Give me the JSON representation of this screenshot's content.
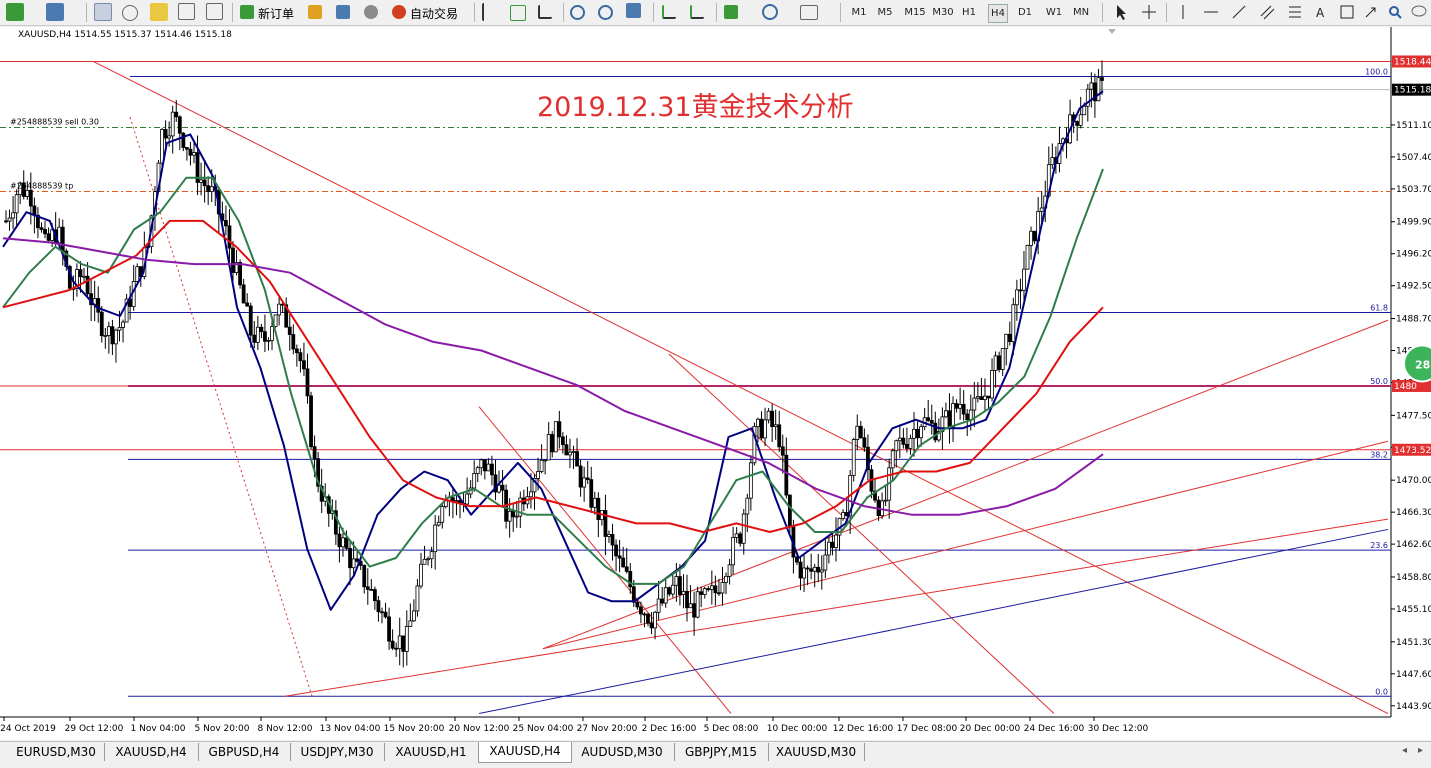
{
  "toolbar": {
    "new_order_label": "新订单",
    "auto_trade_label": "自动交易",
    "timeframes": [
      "M1",
      "M5",
      "M15",
      "M30",
      "H1",
      "H4",
      "D1",
      "W1",
      "MN"
    ],
    "active_timeframe": "H4"
  },
  "chart_header": {
    "symbol_line": "XAUUSD,H4  1514.55 1515.37 1514.46 1515.18"
  },
  "annotation_title": "2019.12.31黄金技术分析",
  "order_labels": [
    {
      "text": "#254888539 sell 0.30",
      "price": 1510.8
    },
    {
      "text": "#254888539 tp",
      "price": 1503.4
    }
  ],
  "fib_labels": [
    {
      "text": "100.0",
      "price": 1516.7
    },
    {
      "text": "61.8",
      "price": 1489.4
    },
    {
      "text": "50.0",
      "price": 1480.9
    },
    {
      "text": "38.2",
      "price": 1472.4
    },
    {
      "text": "23.6",
      "price": 1461.9
    },
    {
      "text": "0.0",
      "price": 1445.0
    }
  ],
  "price_tags": [
    {
      "text": "1518.44",
      "price": 1518.44,
      "color": "#e03030"
    },
    {
      "text": "1515.18",
      "price": 1515.18,
      "color": "#000000"
    },
    {
      "text": "1480",
      "price": 1480.9,
      "color": "#e03030"
    },
    {
      "text": "1473.52",
      "price": 1473.52,
      "color": "#e03030"
    }
  ],
  "bubble_text": "28",
  "chart_data": {
    "type": "candlestick",
    "symbol": "XAUUSD",
    "timeframe": "H4",
    "ylim": [
      1442.6,
      1522.2
    ],
    "y_ticks": [
      "1511.10",
      "1507.40",
      "1503.70",
      "1499.90",
      "1496.20",
      "1492.50",
      "1488.70",
      "1485.00",
      "1481.30",
      "1477.50",
      "1473.80",
      "1470.00",
      "1466.30",
      "1462.60",
      "1458.80",
      "1455.10",
      "1451.30",
      "1447.60",
      "1443.90"
    ],
    "x_ticks": [
      "24 Oct 2019",
      "29 Oct 12:00",
      "1 Nov 04:00",
      "5 Nov 20:00",
      "8 Nov 12:00",
      "13 Nov 04:00",
      "15 Nov 20:00",
      "20 Nov 12:00",
      "25 Nov 04:00",
      "27 Nov 20:00",
      "2 Dec 16:00",
      "5 Dec 08:00",
      "10 Dec 00:00",
      "12 Dec 16:00",
      "17 Dec 08:00",
      "20 Dec 00:00",
      "24 Dec 16:00",
      "30 Dec 12:00"
    ],
    "close_path": [
      1500,
      1504,
      1503,
      1497,
      1499,
      1492,
      1494,
      1489,
      1487,
      1488,
      1493,
      1497,
      1510,
      1512,
      1509,
      1505,
      1503,
      1499,
      1493,
      1487,
      1486,
      1490,
      1488,
      1483,
      1471,
      1466,
      1463,
      1460,
      1458,
      1455,
      1452,
      1451,
      1458,
      1463,
      1469,
      1467,
      1469,
      1472,
      1470,
      1465,
      1468,
      1471,
      1474,
      1476,
      1472,
      1469,
      1466,
      1462,
      1459,
      1456,
      1454,
      1456,
      1458,
      1455,
      1456,
      1457,
      1461,
      1464,
      1475,
      1477,
      1475,
      1461,
      1459,
      1460,
      1463,
      1465,
      1477,
      1470,
      1466,
      1474,
      1475,
      1477,
      1476,
      1477,
      1479,
      1478,
      1480,
      1484,
      1488,
      1495,
      1500,
      1506,
      1510,
      1512,
      1515,
      1515.18
    ],
    "horizontal_lines": [
      {
        "price": 1518.44,
        "color": "#e03030",
        "style": "solid"
      },
      {
        "price": 1516.7,
        "color": "#1a1aa0",
        "style": "solid"
      },
      {
        "price": 1515.18,
        "color": "#b8b8b8",
        "style": "solid"
      },
      {
        "price": 1510.8,
        "color": "#2e7d2e",
        "style": "dashdot"
      },
      {
        "price": 1503.4,
        "color": "#e05a20",
        "style": "dashdot"
      },
      {
        "price": 1489.4,
        "color": "#1a1aa0",
        "style": "solid"
      },
      {
        "price": 1480.9,
        "color": "#8a1aa8",
        "style": "solid"
      },
      {
        "price": 1480.9,
        "color": "#e03030",
        "style": "solid"
      },
      {
        "price": 1473.52,
        "color": "#e03030",
        "style": "solid"
      },
      {
        "price": 1472.4,
        "color": "#1a1aa0",
        "style": "solid"
      },
      {
        "price": 1461.9,
        "color": "#1a1aa0",
        "style": "solid"
      },
      {
        "price": 1445.0,
        "color": "#1a1aa0",
        "style": "solid"
      }
    ],
    "moving_averages": [
      {
        "color": "#000080",
        "values": [
          1497,
          1501,
          1500,
          1493,
          1490,
          1489,
          1494,
          1509,
          1510,
          1505,
          1490,
          1483,
          1474,
          1462,
          1455,
          1459,
          1466,
          1469,
          1471,
          1470,
          1466,
          1469,
          1472,
          1469,
          1463,
          1457,
          1456,
          1456,
          1458,
          1460,
          1463,
          1475,
          1476,
          1468,
          1461,
          1463,
          1465,
          1472,
          1476,
          1477,
          1476,
          1476,
          1477,
          1483,
          1495,
          1507,
          1513,
          1515
        ]
      },
      {
        "color": "#2e7d4a",
        "values": [
          1490,
          1494,
          1497,
          1495,
          1494,
          1499,
          1501,
          1505,
          1505,
          1500,
          1492,
          1480,
          1470,
          1464,
          1460,
          1461,
          1465,
          1468,
          1469,
          1467,
          1466,
          1466,
          1463,
          1460,
          1458,
          1458,
          1460,
          1465,
          1470,
          1471,
          1467,
          1464,
          1464,
          1468,
          1470,
          1474,
          1476,
          1477,
          1479,
          1482,
          1489,
          1498,
          1506
        ]
      },
      {
        "color": "#e01010",
        "values": [
          1490,
          1491,
          1492,
          1494,
          1496,
          1500,
          1500,
          1497,
          1493,
          1487,
          1481,
          1475,
          1470,
          1468,
          1467,
          1467,
          1468,
          1467,
          1466,
          1465,
          1465,
          1464,
          1465,
          1464,
          1465,
          1467,
          1470,
          1471,
          1471,
          1472,
          1476,
          1480,
          1486,
          1490
        ]
      },
      {
        "color": "#8a1aa8",
        "values": [
          1498,
          1497.5,
          1496.5,
          1495.5,
          1495,
          1495,
          1494,
          1491,
          1488,
          1486,
          1485,
          1483,
          1481,
          1478,
          1476,
          1474,
          1472,
          1469,
          1467,
          1466,
          1466,
          1467,
          1469,
          1473
        ]
      }
    ],
    "trend_lines": [
      {
        "from": [
          "29 Oct 12:00",
          1518.4
        ],
        "to": [
          "30 Dec 12:00",
          1443
        ],
        "color": "#e03030"
      },
      {
        "from": [
          "20 Nov 12:00",
          1478.5
        ],
        "to": [
          "5 Dec 08:00",
          1443
        ],
        "color": "#e03030"
      },
      {
        "from": [
          "2 Dec 16:00",
          1484.6
        ],
        "to": [
          "24 Dec 16:00",
          1443
        ],
        "color": "#e03030"
      },
      {
        "from": [
          "8 Nov 12:00",
          1445
        ],
        "to": [
          "30 Dec 12:00",
          1465.5
        ],
        "color": "#e03030"
      },
      {
        "from": [
          "25 Nov 04:00",
          1450.5
        ],
        "to": [
          "30 Dec 12:00",
          1488.5
        ],
        "color": "#e03030"
      },
      {
        "from": [
          "25 Nov 04:00",
          1450.5
        ],
        "to": [
          "30 Dec 12:00",
          1474.5
        ],
        "color": "#e03030"
      },
      {
        "from": [
          "20 Nov 12:00",
          1443
        ],
        "to": [
          "30 Dec 12:00",
          1464.3
        ],
        "color": "#1a1aa0"
      }
    ]
  }
}
